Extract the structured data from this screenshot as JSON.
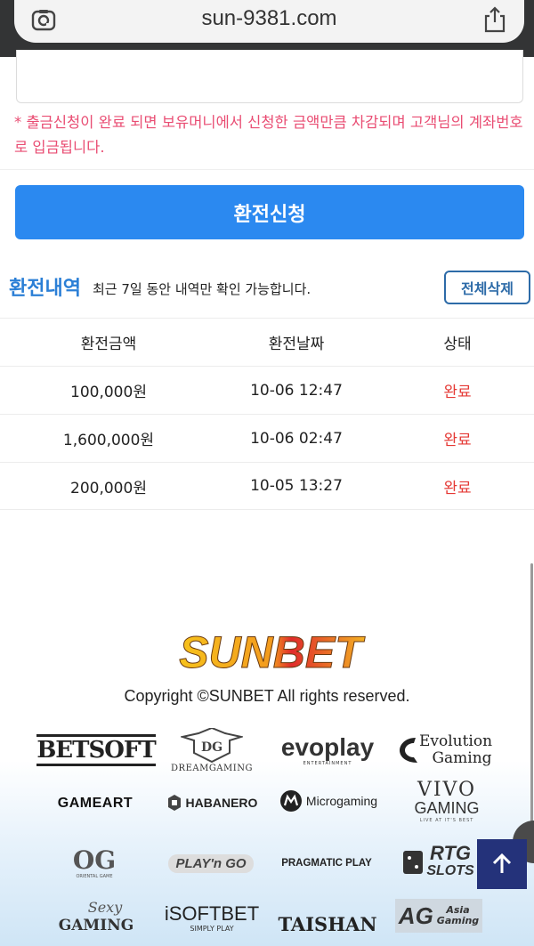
{
  "browser": {
    "url": "sun-9381.com",
    "lens_icon": "google-lens-icon",
    "share_icon": "share-icon"
  },
  "notice": "* 출금신청이 완료 되면 보유머니에서 신청한 금액만큼 차감되며 고객님의 계좌번호로 입금됩니다.",
  "apply_button": "환전신청",
  "history": {
    "title": "환전내역",
    "subtitle": "최근 7일 동안 내역만 확인 가능합니다.",
    "delete_all": "전체삭제",
    "columns": [
      "환전금액",
      "환전날짜",
      "상태"
    ],
    "rows": [
      {
        "amount": "100,000원",
        "date": "10-06 12:47",
        "status": "완료"
      },
      {
        "amount": "1,600,000원",
        "date": "10-06 02:47",
        "status": "완료"
      },
      {
        "amount": "200,000원",
        "date": "10-05 13:27",
        "status": "완료"
      }
    ]
  },
  "footer": {
    "brand": "SUNBET",
    "copyright": "Copyright ©SUNBET All rights reserved.",
    "providers": {
      "betsoft": "BETSOFT",
      "dreamgaming": "DREAMGAMING",
      "evoplay": "evoplay",
      "evoplay_sub": "ENTERTAINMENT",
      "evolution_line1": "Evolution",
      "evolution_line2": "Gaming",
      "gameart": "GAMEART",
      "habanero": "HABANERO",
      "microgaming": "Microgaming",
      "vivo_line1": "VIVO",
      "vivo_line2": "GAMING",
      "vivo_sub": "LIVE AT IT'S BEST",
      "og": "OG",
      "og_sub": "ORIENTAL GAME",
      "playngo": "PLAY'n GO",
      "pragmatic": "PRAGMATIC PLAY",
      "rtg_line1": "RTG",
      "rtg_line2": "SLOTS",
      "sexy_line1": "Sexy",
      "sexy_line2": "GAMING",
      "isoftbet": "iSOFTBET",
      "isoftbet_sub": "SIMPLY PLAY",
      "taishan": "TAISHAN",
      "ag": "AG",
      "ag_sub_line1": "Asia",
      "ag_sub_line2": "Gaming"
    }
  },
  "colors": {
    "accent": "#2b89f0",
    "title_blue": "#2b7fd6",
    "notice_pink": "#e94d73",
    "status_red": "#e53935",
    "top_button": "#24327a"
  },
  "scroll_top_icon": "arrow-up-icon"
}
